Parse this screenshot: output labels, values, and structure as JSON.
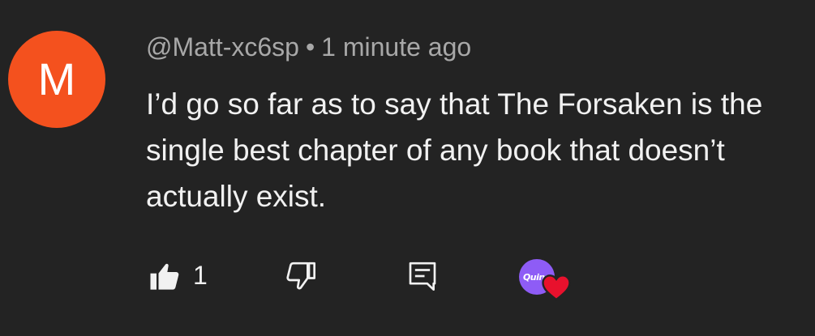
{
  "author": {
    "avatar_letter": "M",
    "avatar_color": "#f4511e",
    "handle": "@Matt-xc6sp",
    "separator": "•",
    "timestamp": "1 minute ago"
  },
  "comment": {
    "text": "I’d go so far as to say that The Forsaken is the single best chapter of any book that doesn’t actually exist."
  },
  "actions": {
    "like_icon": "thumbs-up-icon",
    "like_count": "1",
    "dislike_icon": "thumbs-down-icon",
    "reply_icon": "reply-comment-icon",
    "creator_heart": {
      "creator_avatar_label": "Quinn",
      "creator_avatar_color": "#8e5cf6",
      "heart_color": "#e8112d"
    }
  }
}
